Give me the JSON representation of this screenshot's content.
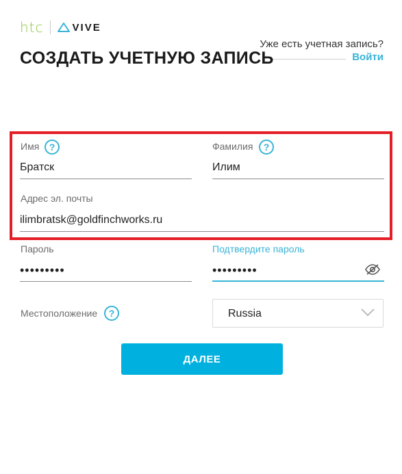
{
  "brand": {
    "htc": "htc",
    "vive": "VIVE"
  },
  "header": {
    "title": "СОЗДАТЬ УЧЕТНУЮ ЗАПИСЬ",
    "has_account": "Уже есть учетная запись?",
    "login_label": "Войти"
  },
  "form": {
    "first_name": {
      "label": "Имя",
      "value": "Братск"
    },
    "last_name": {
      "label": "Фамилия",
      "value": "Илим"
    },
    "email": {
      "label": "Адрес эл. почты",
      "value": "ilimbratsk@goldfinchworks.ru"
    },
    "password": {
      "label": "Пароль",
      "value": "•••••••••"
    },
    "confirm_password": {
      "label": "Подтвердите пароль",
      "value": "•••••••••"
    },
    "location": {
      "label": "Местоположение",
      "value": "Russia"
    },
    "help_glyph": "?",
    "next_label": "ДАЛЕЕ"
  },
  "icons": {
    "help": "help-circle-icon",
    "eye": "eye-off-icon",
    "chevron": "chevron-down-icon",
    "vive": "vive-logo-icon"
  },
  "colors": {
    "accent": "#37b4d8",
    "button": "#00b1e0",
    "htc_green": "#8cc63e",
    "highlight": "#e41e26"
  }
}
